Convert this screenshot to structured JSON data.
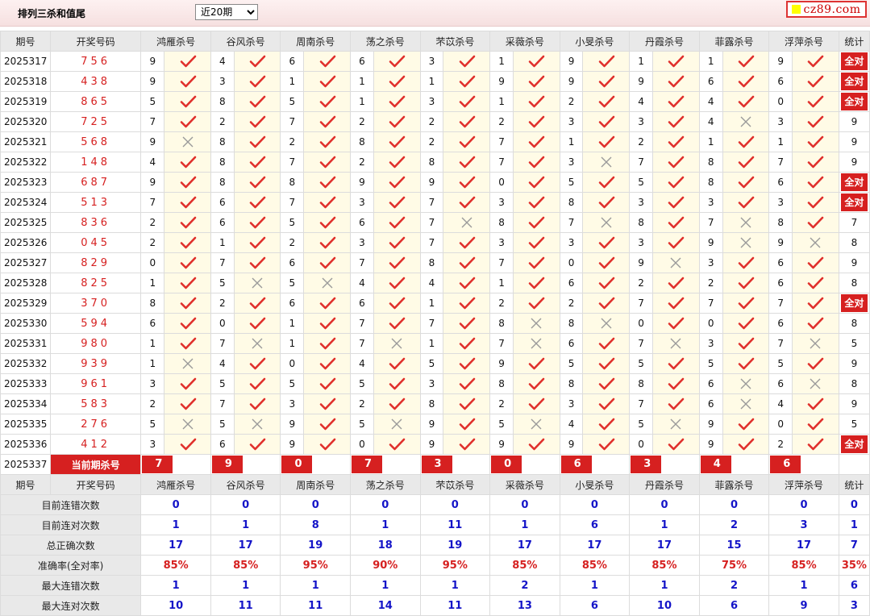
{
  "header": {
    "title": "排列三杀和值尾",
    "period_select": "近20期",
    "logo_text": "cz89.com"
  },
  "columns": {
    "issue": "期号",
    "draw": "开奖号码",
    "experts": [
      "鸿雁杀号",
      "谷风杀号",
      "周南杀号",
      "荡之杀号",
      "芣苡杀号",
      "采薇杀号",
      "小旻杀号",
      "丹霞杀号",
      "菲露杀号",
      "浮萍杀号"
    ],
    "stat": "统计"
  },
  "rows": [
    {
      "issue": "2025317",
      "draw": "756",
      "kills": [
        9,
        4,
        6,
        6,
        3,
        1,
        9,
        1,
        1,
        9
      ],
      "ok": [
        1,
        1,
        1,
        1,
        1,
        1,
        1,
        1,
        1,
        1
      ],
      "stat": "全对"
    },
    {
      "issue": "2025318",
      "draw": "438",
      "kills": [
        9,
        3,
        1,
        1,
        1,
        9,
        9,
        9,
        6,
        6
      ],
      "ok": [
        1,
        1,
        1,
        1,
        1,
        1,
        1,
        1,
        1,
        1
      ],
      "stat": "全对"
    },
    {
      "issue": "2025319",
      "draw": "865",
      "kills": [
        5,
        8,
        5,
        1,
        3,
        1,
        2,
        4,
        4,
        0
      ],
      "ok": [
        1,
        1,
        1,
        1,
        1,
        1,
        1,
        1,
        1,
        1
      ],
      "stat": "全对"
    },
    {
      "issue": "2025320",
      "draw": "725",
      "kills": [
        7,
        2,
        7,
        2,
        2,
        2,
        3,
        3,
        4,
        3
      ],
      "ok": [
        1,
        1,
        1,
        1,
        1,
        1,
        1,
        1,
        0,
        1
      ],
      "stat": "9"
    },
    {
      "issue": "2025321",
      "draw": "568",
      "kills": [
        9,
        8,
        2,
        8,
        2,
        7,
        1,
        2,
        1,
        1
      ],
      "ok": [
        0,
        1,
        1,
        1,
        1,
        1,
        1,
        1,
        1,
        1
      ],
      "stat": "9"
    },
    {
      "issue": "2025322",
      "draw": "148",
      "kills": [
        4,
        8,
        7,
        2,
        8,
        7,
        3,
        7,
        8,
        7
      ],
      "ok": [
        1,
        1,
        1,
        1,
        1,
        1,
        0,
        1,
        1,
        1
      ],
      "stat": "9"
    },
    {
      "issue": "2025323",
      "draw": "687",
      "kills": [
        9,
        8,
        8,
        9,
        9,
        0,
        5,
        5,
        8,
        6
      ],
      "ok": [
        1,
        1,
        1,
        1,
        1,
        1,
        1,
        1,
        1,
        1
      ],
      "stat": "全对"
    },
    {
      "issue": "2025324",
      "draw": "513",
      "kills": [
        7,
        6,
        7,
        3,
        7,
        3,
        8,
        3,
        3,
        3
      ],
      "ok": [
        1,
        1,
        1,
        1,
        1,
        1,
        1,
        1,
        1,
        1
      ],
      "stat": "全对"
    },
    {
      "issue": "2025325",
      "draw": "836",
      "kills": [
        2,
        6,
        5,
        6,
        7,
        8,
        7,
        8,
        7,
        8
      ],
      "ok": [
        1,
        1,
        1,
        1,
        0,
        1,
        0,
        1,
        0,
        1
      ],
      "stat": "7"
    },
    {
      "issue": "2025326",
      "draw": "045",
      "kills": [
        2,
        1,
        2,
        3,
        7,
        3,
        3,
        3,
        9,
        9
      ],
      "ok": [
        1,
        1,
        1,
        1,
        1,
        1,
        1,
        1,
        0,
        0
      ],
      "stat": "8"
    },
    {
      "issue": "2025327",
      "draw": "829",
      "kills": [
        0,
        7,
        6,
        7,
        8,
        7,
        0,
        9,
        3,
        6
      ],
      "ok": [
        1,
        1,
        1,
        1,
        1,
        1,
        1,
        0,
        1,
        1
      ],
      "stat": "9"
    },
    {
      "issue": "2025328",
      "draw": "825",
      "kills": [
        1,
        5,
        5,
        4,
        4,
        1,
        6,
        2,
        2,
        6
      ],
      "ok": [
        1,
        0,
        0,
        1,
        1,
        1,
        1,
        1,
        1,
        1
      ],
      "stat": "8"
    },
    {
      "issue": "2025329",
      "draw": "370",
      "kills": [
        8,
        2,
        6,
        6,
        1,
        2,
        2,
        7,
        7,
        7
      ],
      "ok": [
        1,
        1,
        1,
        1,
        1,
        1,
        1,
        1,
        1,
        1
      ],
      "stat": "全对"
    },
    {
      "issue": "2025330",
      "draw": "594",
      "kills": [
        6,
        0,
        1,
        7,
        7,
        8,
        8,
        0,
        0,
        6
      ],
      "ok": [
        1,
        1,
        1,
        1,
        1,
        0,
        0,
        1,
        1,
        1
      ],
      "stat": "8"
    },
    {
      "issue": "2025331",
      "draw": "980",
      "kills": [
        1,
        7,
        1,
        7,
        1,
        7,
        6,
        7,
        3,
        7
      ],
      "ok": [
        1,
        0,
        1,
        0,
        1,
        0,
        1,
        0,
        1,
        0
      ],
      "stat": "5"
    },
    {
      "issue": "2025332",
      "draw": "939",
      "kills": [
        1,
        4,
        0,
        4,
        5,
        9,
        5,
        5,
        5,
        5
      ],
      "ok": [
        0,
        1,
        1,
        1,
        1,
        1,
        1,
        1,
        1,
        1
      ],
      "stat": "9"
    },
    {
      "issue": "2025333",
      "draw": "961",
      "kills": [
        3,
        5,
        5,
        5,
        3,
        8,
        8,
        8,
        6,
        6
      ],
      "ok": [
        1,
        1,
        1,
        1,
        1,
        1,
        1,
        1,
        0,
        0
      ],
      "stat": "8"
    },
    {
      "issue": "2025334",
      "draw": "583",
      "kills": [
        2,
        7,
        3,
        2,
        8,
        2,
        3,
        7,
        6,
        4
      ],
      "ok": [
        1,
        1,
        1,
        1,
        1,
        1,
        1,
        1,
        0,
        1
      ],
      "stat": "9"
    },
    {
      "issue": "2025335",
      "draw": "276",
      "kills": [
        5,
        5,
        9,
        5,
        9,
        5,
        4,
        5,
        9,
        0
      ],
      "ok": [
        0,
        0,
        1,
        0,
        1,
        0,
        1,
        0,
        1,
        1
      ],
      "stat": "5"
    },
    {
      "issue": "2025336",
      "draw": "412",
      "kills": [
        3,
        6,
        9,
        0,
        9,
        9,
        9,
        0,
        9,
        2
      ],
      "ok": [
        1,
        1,
        1,
        1,
        1,
        1,
        1,
        1,
        1,
        1
      ],
      "stat": "全对"
    }
  ],
  "current": {
    "issue": "2025337",
    "label": "当前期杀号",
    "kills": [
      "7",
      "9",
      "0",
      "7",
      "3",
      "0",
      "6",
      "3",
      "4",
      "6"
    ]
  },
  "summary": [
    {
      "label": "目前连错次数",
      "values": [
        "0",
        "0",
        "0",
        "0",
        "0",
        "0",
        "0",
        "0",
        "0",
        "0"
      ],
      "stat": "0",
      "color": "blue"
    },
    {
      "label": "目前连对次数",
      "values": [
        "1",
        "1",
        "8",
        "1",
        "11",
        "1",
        "6",
        "1",
        "2",
        "3"
      ],
      "stat": "1",
      "color": "blue"
    },
    {
      "label": "总正确次数",
      "values": [
        "17",
        "17",
        "19",
        "18",
        "19",
        "17",
        "17",
        "17",
        "15",
        "17"
      ],
      "stat": "7",
      "color": "blue"
    },
    {
      "label": "准确率(全对率)",
      "values": [
        "85%",
        "85%",
        "95%",
        "90%",
        "95%",
        "85%",
        "85%",
        "85%",
        "75%",
        "85%"
      ],
      "stat": "35%",
      "color": "red"
    },
    {
      "label": "最大连错次数",
      "values": [
        "1",
        "1",
        "1",
        "1",
        "1",
        "2",
        "1",
        "1",
        "2",
        "1"
      ],
      "stat": "6",
      "color": "blue"
    },
    {
      "label": "最大连对次数",
      "values": [
        "10",
        "11",
        "11",
        "14",
        "11",
        "13",
        "6",
        "10",
        "6",
        "9"
      ],
      "stat": "3",
      "color": "blue"
    }
  ],
  "colors": {
    "accent": "#d62020",
    "blue": "#1414c8",
    "header_bg": "#e9e9e9",
    "mark_bg": "#fffbe6"
  },
  "icons": {
    "correct": "check-icon",
    "wrong": "cross-icon"
  }
}
